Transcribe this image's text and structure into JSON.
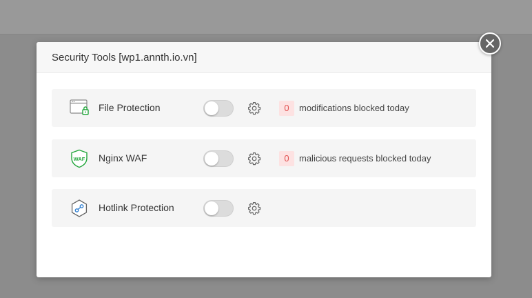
{
  "modal": {
    "title": "Security Tools [wp1.annth.io.vn]"
  },
  "tools": [
    {
      "name": "File Protection",
      "icon": "file-lock-icon",
      "enabled": false,
      "count": "0",
      "count_label": "modifications blocked today"
    },
    {
      "name": "Nginx WAF",
      "icon": "waf-shield-icon",
      "icon_text": "WAF",
      "enabled": false,
      "count": "0",
      "count_label": "malicious requests blocked today"
    },
    {
      "name": "Hotlink Protection",
      "icon": "hotlink-hexagon-icon",
      "enabled": false
    }
  ],
  "colors": {
    "overlay": "#8c8c8c",
    "badge_bg": "#fde2e2",
    "badge_text": "#e05050",
    "accent_green": "#20a53a",
    "toggle_off": "#dcdcdc"
  }
}
